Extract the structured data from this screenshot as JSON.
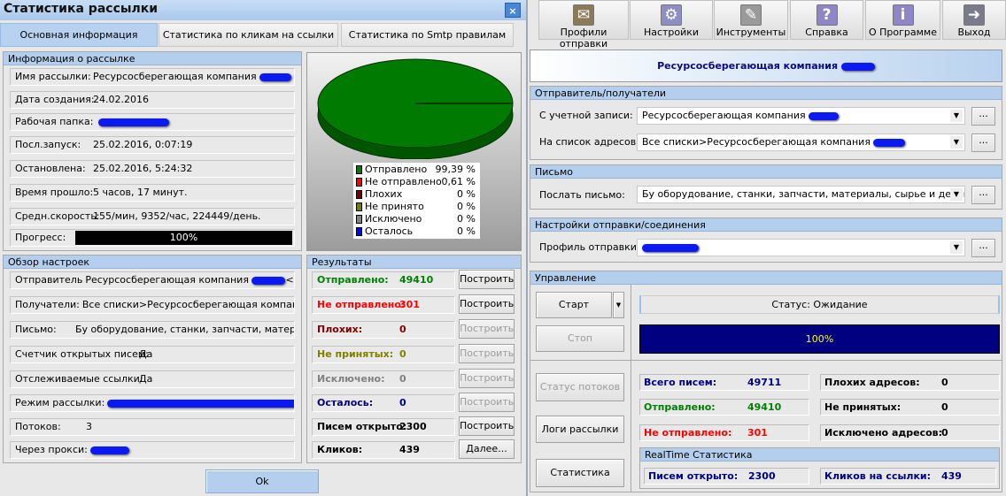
{
  "dialog": {
    "title": "Статистика рассылки",
    "close": "×",
    "tabs": [
      "Основная информация",
      "Статистика по кликам на ссылки",
      "Статистика по Smtp правилам"
    ],
    "info": {
      "header": "Информация о рассылке",
      "rows": [
        {
          "label": "Имя рассылки:",
          "value": "Ресурсосберегающая компания"
        },
        {
          "label": "Дата создания:",
          "value": "24.02.2016"
        },
        {
          "label": "Рабочая папка:",
          "value": ""
        },
        {
          "label": "Посл.запуск:",
          "value": "25.02.2016, 0:07:19"
        },
        {
          "label": "Остановлена:",
          "value": "25.02.2016, 5:24:32"
        },
        {
          "label": "Время прошло:",
          "value": "5 часов, 17 минут."
        },
        {
          "label": "Средн.скорость:",
          "value": "155/мин, 9352/час, 224449/день."
        }
      ],
      "progress_label": "Прогресс:",
      "progress_text": "100%",
      "progress": 100
    },
    "pie": {
      "legend": [
        {
          "label": "Отправлено",
          "value": "99,39 %",
          "color": "#007a00"
        },
        {
          "label": "Не отправлено",
          "value": "0,61 %",
          "color": "#ff0000"
        },
        {
          "label": "Плохих",
          "value": "0 %",
          "color": "#7a0000"
        },
        {
          "label": "Не принято",
          "value": "0 %",
          "color": "#7a7a00"
        },
        {
          "label": "Исключено",
          "value": "0 %",
          "color": "#808080"
        },
        {
          "label": "Осталось",
          "value": "0 %",
          "color": "#0000ff"
        }
      ]
    },
    "settings": {
      "header": "Обзор настроек",
      "rows": [
        {
          "label": "Отправитель",
          "value": "Ресурсосберегающая компания",
          "suffix": "<[%%OF"
        },
        {
          "label": "Получатели:",
          "value": "Все списки>Ресурсосберегающая компания"
        },
        {
          "label": "Письмо:",
          "value": "Бу оборудование, станки, запчасти, материаль"
        },
        {
          "label": "Счетчик открытых писем:",
          "value": "Да"
        },
        {
          "label": "Отслеживаемые ссылки:",
          "value": "Да"
        },
        {
          "label": "Режим рассылки:",
          "value": ""
        },
        {
          "label": "Потоков:",
          "value": "3"
        },
        {
          "label": "Через прокси:",
          "value": ""
        }
      ]
    },
    "results": {
      "header": "Результаты",
      "rows": [
        {
          "label": "Отправлено:",
          "value": "49410",
          "color": "#008000",
          "button": "Построить",
          "enabled": true
        },
        {
          "label": "Не отправлено:",
          "value": "301",
          "color": "#ff0000",
          "button": "Построить",
          "enabled": true
        },
        {
          "label": "Плохих:",
          "value": "0",
          "color": "#800000",
          "button": "Построить",
          "enabled": false
        },
        {
          "label": "Не принятых:",
          "value": "0",
          "color": "#808000",
          "button": "Построить",
          "enabled": false
        },
        {
          "label": "Исключено:",
          "value": "0",
          "color": "#808080",
          "button": "Построить",
          "enabled": false
        },
        {
          "label": "Осталось:",
          "value": "0",
          "color": "#000080",
          "button": "Построить",
          "enabled": false
        },
        {
          "label": "Писем открыто:",
          "value": "2300",
          "color": "#000000",
          "button": "Построить",
          "enabled": true
        },
        {
          "label": "Кликов:",
          "value": "439",
          "color": "#000000",
          "button": "Далее...",
          "enabled": true
        }
      ]
    },
    "ok": "Ok"
  },
  "toolbar": [
    {
      "label": "Профили отправки",
      "icon": "envelope-folder-icon",
      "glyph": "✉",
      "color": "#8a7a5a"
    },
    {
      "label": "Настройки",
      "icon": "settings-gears-icon",
      "glyph": "⚙",
      "color": "#8e8ec4"
    },
    {
      "label": "Инструменты",
      "icon": "tools-icon",
      "glyph": "✎",
      "color": "#9a9a9a"
    },
    {
      "label": "Справка",
      "icon": "help-icon",
      "glyph": "?",
      "color": "#8e86c6"
    },
    {
      "label": "О Программе",
      "icon": "info-icon",
      "glyph": "i",
      "color": "#8e86c6"
    },
    {
      "label": "Выход",
      "icon": "exit-door-icon",
      "glyph": "➜",
      "color": "#7a7a8a"
    }
  ],
  "main": {
    "company": "Ресурсосберегающая компания",
    "sender": {
      "header": "Отправитель/получатели",
      "account_label": "С учетной записи:",
      "account_value": "Ресурсосберегающая компания",
      "list_label": "На список адресов:",
      "list_value": "Все списки>Ресурсосберегающая компания"
    },
    "letter": {
      "header": "Письмо",
      "label": "Послать письмо:",
      "value": "Бу оборудование, станки, запчасти, материалы, сырье и деловые с"
    },
    "conn": {
      "header": "Настройки отправки/соединения",
      "label": "Профиль отправки:",
      "value": ""
    },
    "browse": "...",
    "control": {
      "header": "Управление",
      "start": "Старт",
      "stop": "Стоп",
      "threads": "Статус потоков",
      "logs": "Логи рассылки",
      "stats": "Статистика",
      "status": "Статус: Ожидание",
      "progress_text": "100%",
      "progress": 100,
      "stats_left": [
        {
          "label": "Всего писем:",
          "value": "49711",
          "color": "#000080"
        },
        {
          "label": "Отправлено:",
          "value": "49410",
          "color": "#008000"
        },
        {
          "label": "Не отправлено:",
          "value": "301",
          "color": "#ff0000"
        }
      ],
      "stats_right": [
        {
          "label": "Плохих адресов:",
          "value": "0"
        },
        {
          "label": "Не принятых:",
          "value": "0"
        },
        {
          "label": "Исключено адресов:",
          "value": "0"
        }
      ],
      "realtime": {
        "header": "RealTime Статистика",
        "opened_label": "Писем открыто:",
        "opened": "2300",
        "clicks_label": "Кликов на ссылки:",
        "clicks": "439"
      }
    }
  }
}
